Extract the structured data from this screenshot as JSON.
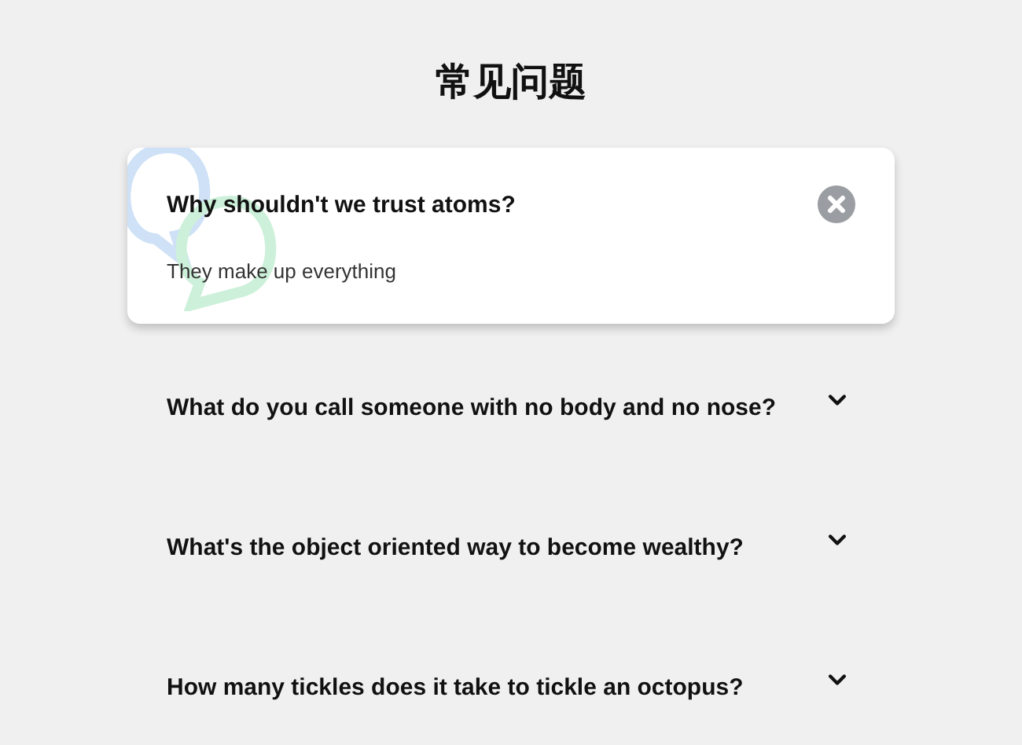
{
  "title": "常见问题",
  "faqs": [
    {
      "question": "Why shouldn't we trust atoms?",
      "answer": "They make up everything",
      "expanded": true
    },
    {
      "question": "What do you call someone with no body and no nose?",
      "expanded": false
    },
    {
      "question": "What's the object oriented way to become wealthy?",
      "expanded": false
    },
    {
      "question": "How many tickles does it take to tickle an octopus?",
      "expanded": false
    }
  ]
}
